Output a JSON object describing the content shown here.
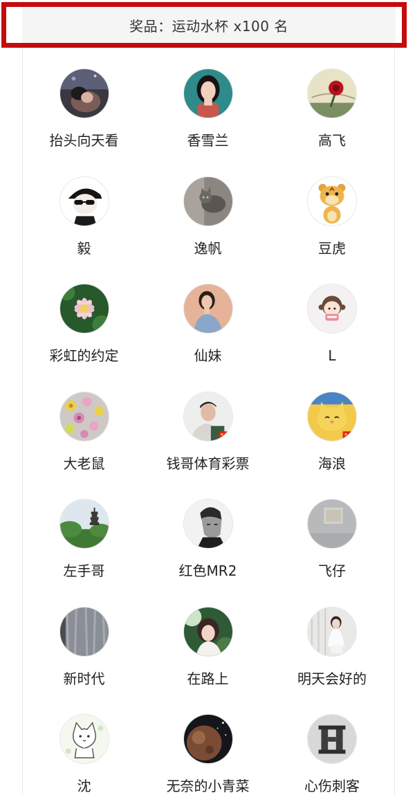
{
  "prize": {
    "label": "奖品：运动水杯 x100 名"
  },
  "winners": [
    {
      "name": "抬头向天看",
      "avatar": "girl-night-photo-icon"
    },
    {
      "name": "香雪兰",
      "avatar": "girl-portrait-icon"
    },
    {
      "name": "高飞",
      "avatar": "rose-book-icon"
    },
    {
      "name": "毅",
      "avatar": "cartoon-sunglasses-boy-icon"
    },
    {
      "name": "逸帆",
      "avatar": "kitten-photo-icon"
    },
    {
      "name": "豆虎",
      "avatar": "cartoon-tiger-icon"
    },
    {
      "name": "彩虹的约定",
      "avatar": "lotus-flower-icon"
    },
    {
      "name": "仙妹",
      "avatar": "woman-portrait-icon"
    },
    {
      "name": "L",
      "avatar": "cartoon-girl-icon"
    },
    {
      "name": "大老鼠",
      "avatar": "paper-flowers-icon"
    },
    {
      "name": "钱哥体育彩票",
      "avatar": "man-selfie-flag-icon"
    },
    {
      "name": "海浪",
      "avatar": "lucky-cat-flag-icon"
    },
    {
      "name": "左手哥",
      "avatar": "pagoda-landscape-icon"
    },
    {
      "name": "红色MR2",
      "avatar": "man-bw-portrait-icon"
    },
    {
      "name": "飞仔",
      "avatar": "wall-poster-icon"
    },
    {
      "name": "新时代",
      "avatar": "curtain-texture-icon"
    },
    {
      "name": "在路上",
      "avatar": "woman-hat-portrait-icon"
    },
    {
      "name": "明天会好的",
      "avatar": "girl-sitting-icon"
    },
    {
      "name": "沈",
      "avatar": "cartoon-cat-icon"
    },
    {
      "name": "无奈的小青菜",
      "avatar": "planet-space-icon"
    },
    {
      "name": "心伤刺客",
      "avatar": "hermes-logo-icon"
    }
  ]
}
